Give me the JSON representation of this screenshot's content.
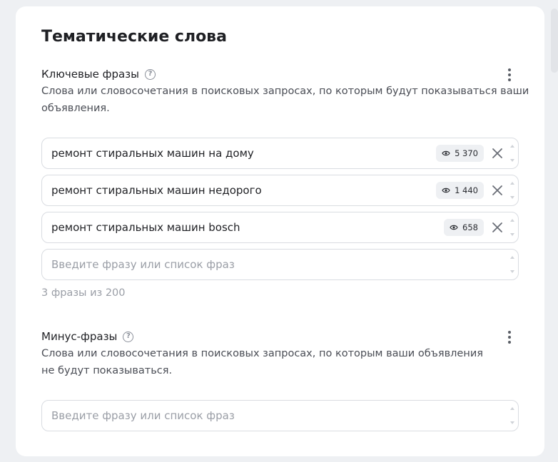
{
  "card": {
    "title": "Тематические слова"
  },
  "keywords": {
    "label": "Ключевые фразы",
    "description_line1": "Слова или словосочетания в поисковых запросах, по которым будут показываться ваши",
    "description_line2": "объявления.",
    "phrases": [
      {
        "text": "ремонт стиральных машин на дому",
        "impressions": "5 370"
      },
      {
        "text": "ремонт стиральных машин недорого",
        "impressions": "1 440"
      },
      {
        "text": "ремонт стиральных машин bosch",
        "impressions": "658"
      }
    ],
    "input_placeholder": "Введите фразу или список фраз",
    "counter": "3 фразы из 200"
  },
  "minus": {
    "label": "Минус-фразы",
    "description_line1": "Слова или словосочетания в поисковых запросах, по которым ваши объявления",
    "description_line2": "не будут показываться.",
    "input_placeholder": "Введите фразу или список фраз"
  },
  "icons": {
    "help": "question-circle-icon",
    "more": "kebab-icon",
    "eye": "eye-icon",
    "remove": "close-icon"
  },
  "colors": {
    "background": "#eef0f3",
    "card": "#ffffff",
    "text": "#1f2024",
    "muted": "#9a9ea6",
    "border": "#d9dce1"
  }
}
